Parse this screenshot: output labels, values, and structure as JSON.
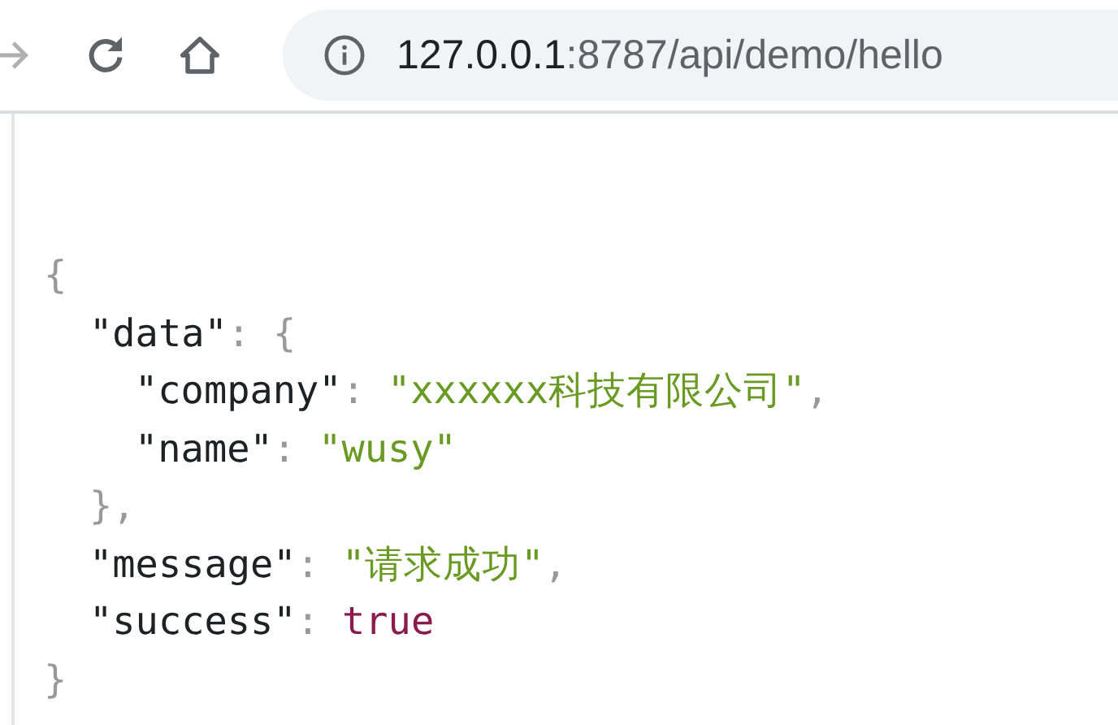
{
  "toolbar": {
    "nav_buttons": [
      {
        "kind": "forward",
        "disabled": true
      },
      {
        "kind": "reload",
        "disabled": false
      },
      {
        "kind": "home",
        "disabled": false
      }
    ],
    "address_bar": {
      "host": "127.0.0.1",
      "path": ":8787/api/demo/hello"
    }
  },
  "json_view": {
    "open": "{",
    "close": "}",
    "members": [
      {
        "key": "\"data\"",
        "colon": ":",
        "open": "{",
        "close": "}",
        "comma": ",",
        "members": [
          {
            "key": "\"company\"",
            "colon": ":",
            "value": "\"xxxxxx科技有限公司\"",
            "kind": "string",
            "comma": ","
          },
          {
            "key": "\"name\"",
            "colon": ":",
            "value": "\"wusy\"",
            "kind": "string"
          }
        ]
      },
      {
        "key": "\"message\"",
        "colon": ":",
        "value": "\"请求成功\"",
        "kind": "string",
        "comma": ","
      },
      {
        "key": "\"success\"",
        "colon": ":",
        "value": "true",
        "kind": "boolean"
      }
    ]
  }
}
